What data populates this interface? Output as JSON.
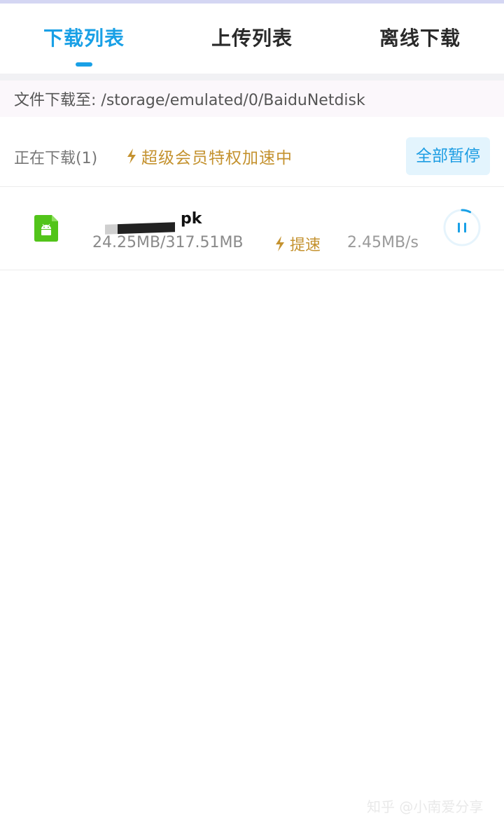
{
  "tabs": [
    {
      "label": "下载列表",
      "active": true
    },
    {
      "label": "上传列表",
      "active": false
    },
    {
      "label": "离线下载",
      "active": false
    }
  ],
  "path_bar": {
    "text": "文件下载至: /storage/emulated/0/BaiduNetdisk"
  },
  "status": {
    "downloading_label": "正在下载(1)",
    "vip_text": "超级会员特权加速中",
    "pause_all_label": "全部暂停"
  },
  "download_item": {
    "icon": "android-apk-icon",
    "file_name_visible": "pk",
    "size_text": "24.25MB/317.51MB",
    "boost_label": "提速",
    "speed": "2.45MB/s",
    "progress_fraction": 0.0764
  },
  "watermark": "知乎 @小南爱分享",
  "colors": {
    "accent": "#19a0e6",
    "vip_gold": "#c4922f",
    "apk_green": "#52c41a",
    "pause_all_bg": "#e3f4fd"
  }
}
